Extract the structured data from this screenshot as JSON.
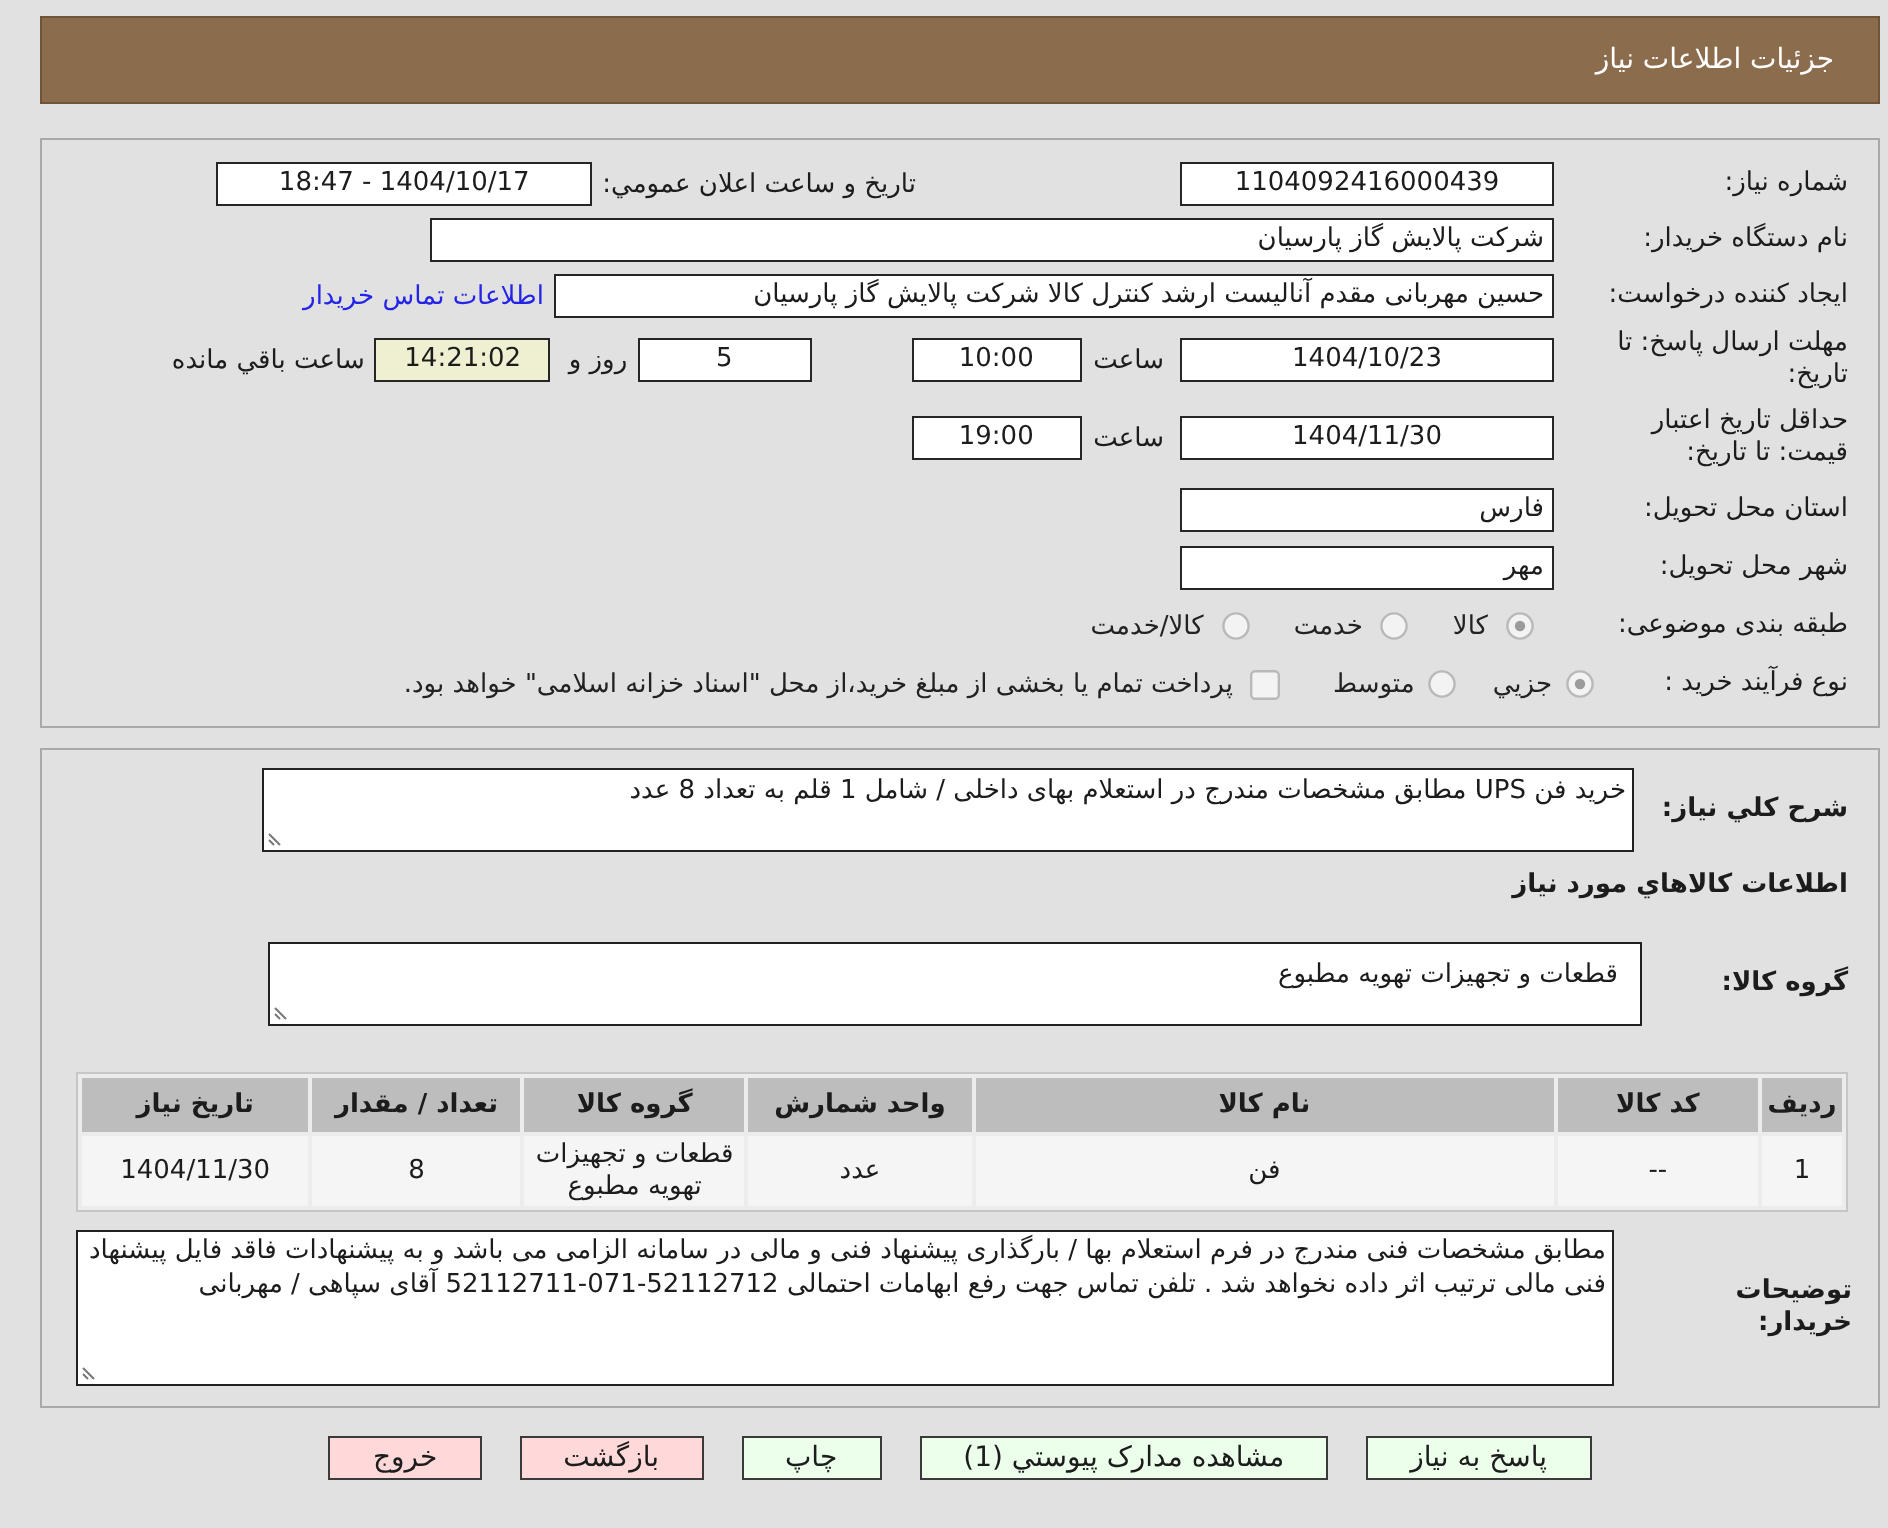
{
  "header": {
    "title": "جزئیات اطلاعات نیاز"
  },
  "need": {
    "number": {
      "label": "شماره نیاز:",
      "value": "1104092416000439"
    },
    "announcement": {
      "label": "تاریخ و ساعت اعلان عمومي:",
      "value": "1404/10/17 - 18:47"
    },
    "buyer": {
      "label": "نام دستگاه خریدار:",
      "value": "شرکت پالایش گاز پارسیان"
    },
    "requester": {
      "label": "ایجاد کننده درخواست:",
      "value": "حسین مهربانی مقدم آنالیست ارشد کنترل کالا  شرکت پالایش گاز پارسیان",
      "link": "اطلاعات تماس خریدار"
    },
    "reply_deadline": {
      "label": "مهلت ارسال پاسخ: تا تاریخ:",
      "date": "1404/10/23",
      "time_label": "ساعت",
      "time": "10:00",
      "days": "5",
      "days_label": "روز و",
      "remaining": "14:21:02",
      "remaining_label": "ساعت باقي مانده"
    },
    "price_validity": {
      "label": "حداقل تاریخ اعتبار قیمت: تا تاریخ:",
      "date": "1404/11/30",
      "time_label": "ساعت",
      "time": "19:00"
    },
    "province": {
      "label": "استان محل تحویل:",
      "value": "فارس"
    },
    "city": {
      "label": "شهر محل تحویل:",
      "value": "مهر"
    },
    "category": {
      "label": "طبقه بندی موضوعی:",
      "options": [
        {
          "label": "کالا",
          "selected": true
        },
        {
          "label": "خدمت",
          "selected": false
        },
        {
          "label": "کالا/خدمت",
          "selected": false
        }
      ]
    },
    "purchase_process": {
      "label": "نوع فرآیند خرید :",
      "options": [
        {
          "label": "جزيي",
          "selected": true
        },
        {
          "label": "متوسط",
          "selected": false
        }
      ],
      "treasury_payment": {
        "label": "پرداخت تمام یا بخشی از مبلغ خرید،از محل \"اسناد خزانه اسلامی\" خواهد بود.",
        "checked": false
      }
    }
  },
  "summary": {
    "label": "شرح کلي نیاز:",
    "value": "خرید فن UPS مطابق مشخصات مندرج در استعلام بهای داخلی / شامل 1 قلم به تعداد 8 عدد"
  },
  "goods": {
    "title": "اطلاعات کالاهاي مورد نیاز",
    "group": {
      "label": "گروه کالا:",
      "value": "قطعات و تجهیزات تهویه مطبوع"
    },
    "table": {
      "columns": [
        "ردیف",
        "کد کالا",
        "نام کالا",
        "واحد شمارش",
        "گروه کالا",
        "تعداد / مقدار",
        "تاریخ نیاز"
      ],
      "rows": [
        [
          "1",
          "--",
          "فن",
          "عدد",
          "قطعات و تجهیزات تهویه مطبوع",
          "8",
          "1404/11/30"
        ]
      ]
    }
  },
  "buyer_notes": {
    "label": "توضیحات خریدار:",
    "value": "مطابق مشخصات فنی مندرج در فرم استعلام بها / بارگذاری پیشنهاد فنی و مالی در سامانه الزامی می باشد و به پیشنهادات فاقد فایل پیشنهاد فنی مالی ترتیب اثر داده نخواهد شد . تلفن تماس جهت رفع ابهامات احتمالی 52112712-071-52112711 آقای سپاهی / مهربانی"
  },
  "buttons": [
    {
      "label": "پاسخ به نیاز",
      "color": "#ebffeb"
    },
    {
      "label": "مشاهده مدارک پیوستي (1)",
      "color": "#ebffeb"
    },
    {
      "label": "چاپ",
      "color": "#ebffeb"
    },
    {
      "label": "بازگشت",
      "color": "#ffd9d9"
    },
    {
      "label": "خروج",
      "color": "#ffd9d9"
    }
  ]
}
